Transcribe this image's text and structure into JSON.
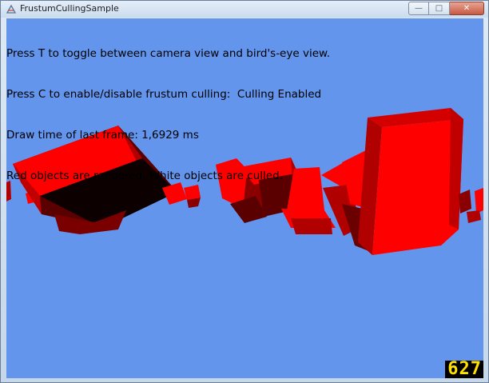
{
  "window": {
    "title": "FrustumCullingSample",
    "icon": "app-icon",
    "buttons": {
      "minimize": "—",
      "maximize": "□",
      "close": "✕"
    }
  },
  "hud": {
    "lines": [
      "Press T to toggle between camera view and bird's-eye view.",
      "Press C to enable/disable frustum culling:  Culling Enabled",
      "Draw time of last frame: 1,6929 ms",
      "Red objects are rendered. White objects are culled."
    ]
  },
  "fps_counter": "627",
  "colors": {
    "background": "#6495ed",
    "object_light": "#ff0000",
    "object_mid": "#b00000",
    "object_dark": "#5a0000",
    "fps_text": "#ffe000"
  }
}
